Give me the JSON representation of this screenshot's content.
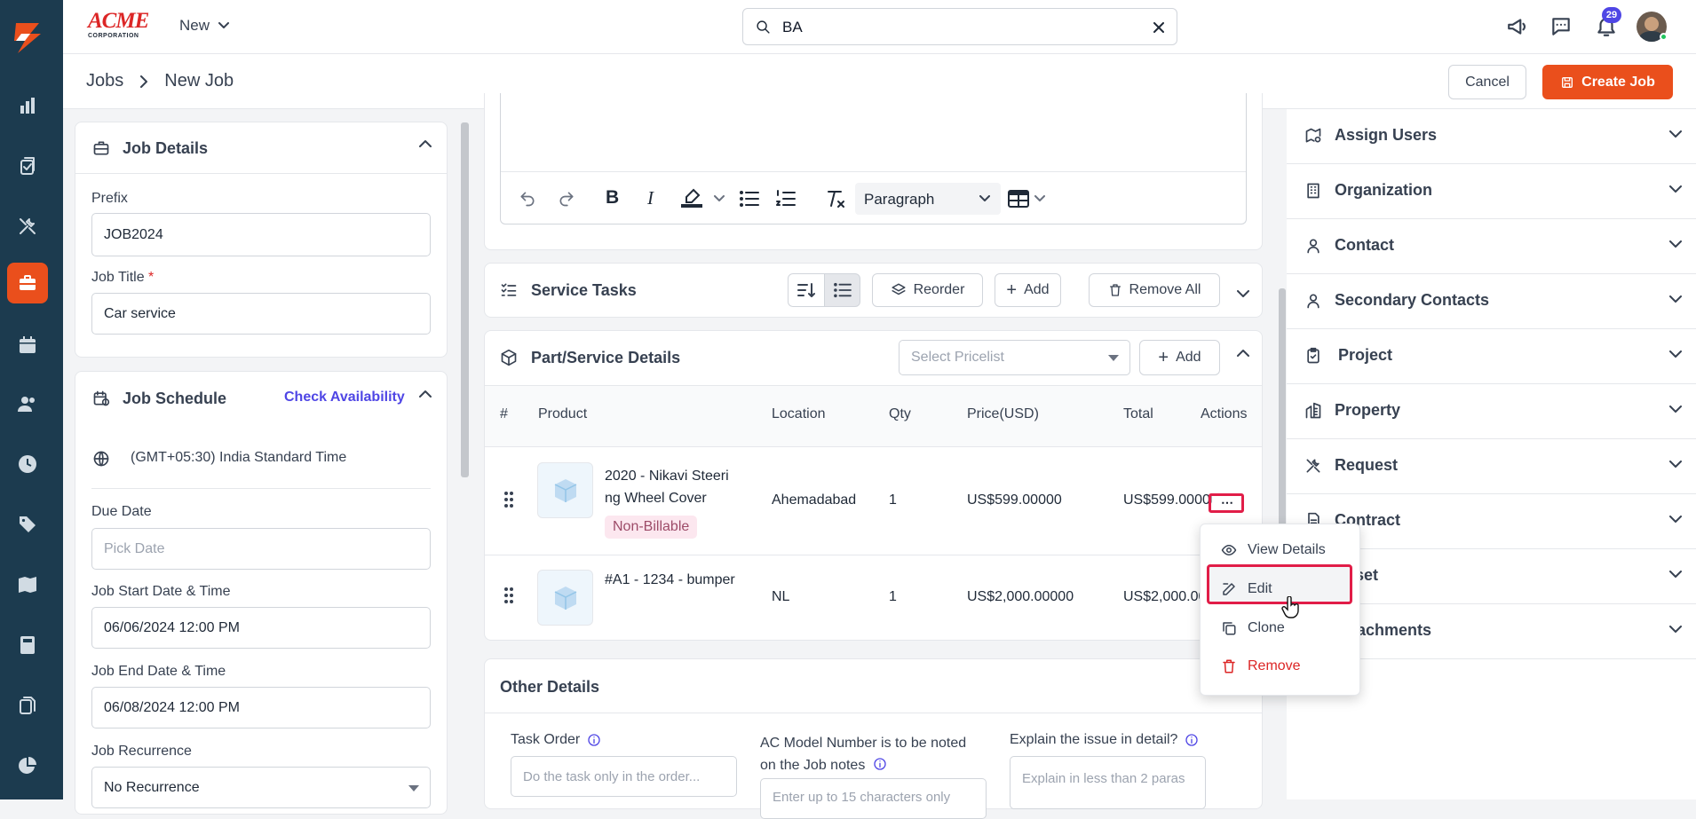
{
  "brand": {
    "logo_text": "ACME",
    "logo_sub": "CORPORATION",
    "new_label": "New"
  },
  "search": {
    "value": "BA",
    "placeholder": "Search"
  },
  "notifications": {
    "count": "29"
  },
  "breadcrumb": {
    "root": "Jobs",
    "current": "New Job"
  },
  "actions": {
    "cancel": "Cancel",
    "create": "Create Job"
  },
  "job_details": {
    "title": "Job Details",
    "prefix_label": "Prefix",
    "prefix_value": "JOB2024",
    "title_label": "Job Title",
    "required_mark": "*",
    "title_value": "Car service"
  },
  "schedule": {
    "title": "Job Schedule",
    "check": "Check Availability",
    "timezone": "(GMT+05:30) India Standard Time",
    "due_label": "Due Date",
    "due_placeholder": "Pick Date",
    "start_label": "Job Start Date & Time",
    "start_value": "06/06/2024 12:00 PM",
    "end_label": "Job End Date & Time",
    "end_value": "06/08/2024 12:00 PM",
    "recurrence_label": "Job Recurrence",
    "recurrence_value": "No Recurrence"
  },
  "editor": {
    "paragraph": "Paragraph"
  },
  "service_tasks": {
    "title": "Service Tasks",
    "reorder": "Reorder",
    "add": "Add",
    "remove_all": "Remove All"
  },
  "parts": {
    "title": "Part/Service Details",
    "pricelist_placeholder": "Select Pricelist",
    "add": "Add",
    "columns": [
      "#",
      "Product",
      "Location",
      "Qty",
      "Price(USD)",
      "Total",
      "Actions"
    ],
    "rows": [
      {
        "name_line1": "2020 - Nikavi Steeri",
        "name_line2": "ng Wheel Cover",
        "badge": "Non-Billable",
        "location": "Ahemadabad",
        "qty": "1",
        "price": "US$599.00000",
        "total": "US$599.00000"
      },
      {
        "name_line1": "#A1 - 1234 - bumper",
        "name_line2": "",
        "badge": "",
        "location": "NL",
        "qty": "1",
        "price": "US$2,000.00000",
        "total": "US$2,000.00000"
      }
    ]
  },
  "context_menu": {
    "view": "View Details",
    "edit": "Edit",
    "clone": "Clone",
    "remove": "Remove"
  },
  "other": {
    "title": "Other Details",
    "task_order_label": "Task Order",
    "task_order_placeholder": "Do the task only in the order...",
    "ac_label_1": "AC Model Number is to be noted",
    "ac_label_2": "on the Job notes",
    "ac_placeholder": "Enter up to 15 characters only",
    "issue_label": "Explain the issue in detail?",
    "issue_placeholder": "Explain in less than 2 paras"
  },
  "right_panel": [
    {
      "label": "Assign Users",
      "icon": "map-user-icon"
    },
    {
      "label": "Organization",
      "icon": "building-icon"
    },
    {
      "label": "Contact",
      "icon": "user-icon"
    },
    {
      "label": "Secondary Contacts",
      "icon": "user-icon"
    },
    {
      "label": "Project",
      "icon": "clipboard-icon"
    },
    {
      "label": "Property",
      "icon": "property-icon"
    },
    {
      "label": "Request",
      "icon": "tools-icon"
    },
    {
      "label": "Contract",
      "icon": "document-icon"
    },
    {
      "label": "Asset",
      "icon": "asset-icon"
    },
    {
      "label": "Attachments",
      "icon": "paperclip-icon"
    }
  ],
  "colors": {
    "sidebar": "#1c3b4f",
    "accent": "#ea4f1c",
    "link": "#4f46e5",
    "danger": "#dc2626"
  }
}
